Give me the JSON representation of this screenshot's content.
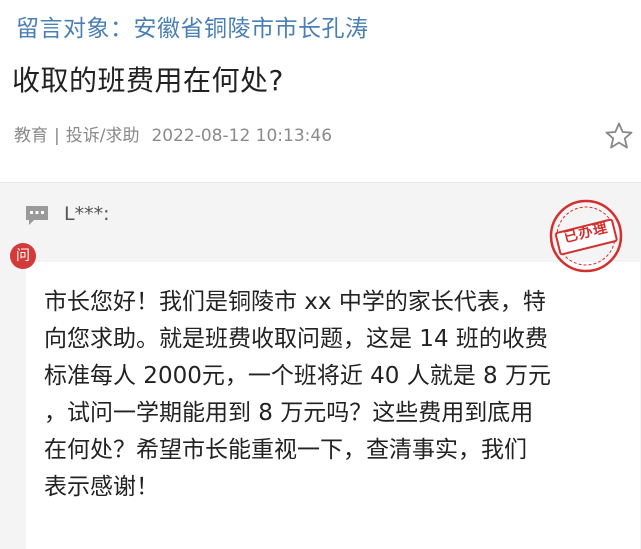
{
  "message": {
    "recipient": "留言对象：安徽省铜陵市市长孔涛",
    "title": "收取的班费用在何处?",
    "category": "教育",
    "type": "投诉/求助",
    "datetime": "2022-08-12 10:13:46",
    "favorite_icon": "star-outline-icon"
  },
  "thread": {
    "comment_icon": "comment-bubble-icon",
    "author": "L***:",
    "question_badge": "问",
    "status_stamp": "已办理",
    "body_lines": [
      "市长您好！我们是铜陵市 xx 中学的家长代表，特",
      "向您求助。就是班费收取问题，这是 14 班的收费",
      "标准每人 2000元，一个班将近 40 人就是 8 万元",
      "，试问一学期能用到 8 万元吗？这些费用到底用",
      "在何处？希望市长能重视一下，查清事实，我们",
      "表示感谢！"
    ]
  },
  "colors": {
    "recipient_blue": "#4a7fb5",
    "stamp_red": "#d32f2f",
    "badge_red": "#d33a3a"
  }
}
